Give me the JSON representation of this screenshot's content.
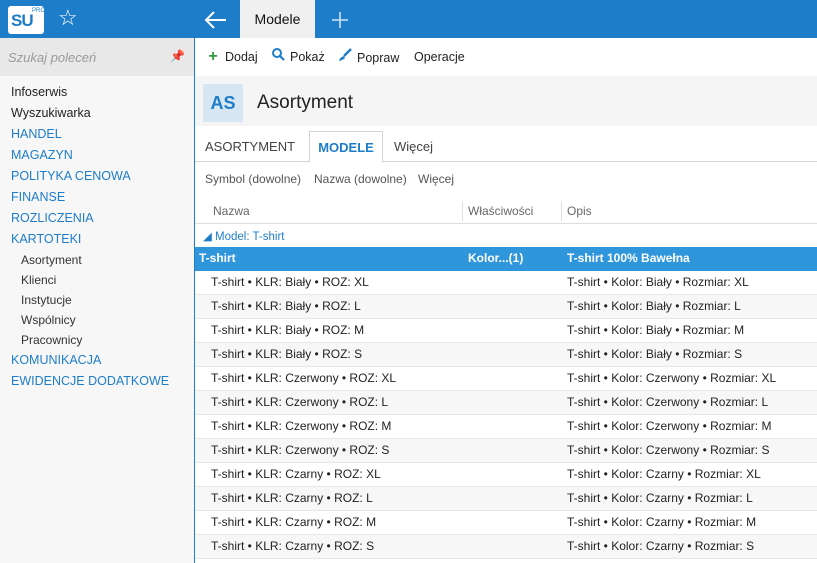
{
  "app": {
    "logo_text": "SU",
    "logo_sup": "PRO",
    "active_tab": "Modele"
  },
  "sidebar": {
    "search_placeholder": "Szukaj poleceń",
    "items": [
      {
        "label": "Infoserwis",
        "kind": "item"
      },
      {
        "label": "Wyszukiwarka",
        "kind": "item"
      },
      {
        "label": "HANDEL",
        "kind": "section"
      },
      {
        "label": "MAGAZYN",
        "kind": "section"
      },
      {
        "label": "POLITYKA CENOWA",
        "kind": "section"
      },
      {
        "label": "FINANSE",
        "kind": "section"
      },
      {
        "label": "ROZLICZENIA",
        "kind": "section"
      },
      {
        "label": "KARTOTEKI",
        "kind": "section"
      },
      {
        "label": "Asortyment",
        "kind": "sub"
      },
      {
        "label": "Klienci",
        "kind": "sub"
      },
      {
        "label": "Instytucje",
        "kind": "sub"
      },
      {
        "label": "Wspólnicy",
        "kind": "sub"
      },
      {
        "label": "Pracownicy",
        "kind": "sub"
      },
      {
        "label": "KOMUNIKACJA",
        "kind": "section"
      },
      {
        "label": "EWIDENCJE DODATKOWE",
        "kind": "section"
      }
    ]
  },
  "toolbar": {
    "add_label": "Dodaj",
    "show_label": "Pokaż",
    "edit_label": "Popraw",
    "operations_label": "Operacje"
  },
  "header": {
    "badge": "AS",
    "title": "Asortyment"
  },
  "tabs": {
    "asortyment": "ASORTYMENT",
    "modele": "MODELE",
    "more": "Więcej"
  },
  "filters": {
    "symbol": "Symbol (dowolne)",
    "name": "Nazwa (dowolne)",
    "more": "Więcej"
  },
  "grid": {
    "columns": [
      "Nazwa",
      "Właściwości",
      "Opis"
    ],
    "group_label": "◢ Model: T-shirt",
    "rows": [
      {
        "name": "T-shirt",
        "props": "Kolor...(1)",
        "desc": "T-shirt 100% Bawełna",
        "selected": true
      },
      {
        "name": "T-shirt  • KLR: Biały • ROZ: XL",
        "props": "",
        "desc": "T-shirt  • Kolor: Biały • Rozmiar: XL"
      },
      {
        "name": "T-shirt  • KLR: Biały • ROZ: L",
        "props": "",
        "desc": "T-shirt  • Kolor: Biały • Rozmiar: L"
      },
      {
        "name": "T-shirt  • KLR: Biały • ROZ: M",
        "props": "",
        "desc": "T-shirt  • Kolor: Biały • Rozmiar: M"
      },
      {
        "name": "T-shirt  • KLR: Biały • ROZ: S",
        "props": "",
        "desc": "T-shirt  • Kolor: Biały • Rozmiar: S"
      },
      {
        "name": "T-shirt  • KLR: Czerwony • ROZ: XL",
        "props": "",
        "desc": "T-shirt  • Kolor: Czerwony • Rozmiar: XL"
      },
      {
        "name": "T-shirt  • KLR: Czerwony • ROZ: L",
        "props": "",
        "desc": "T-shirt  • Kolor: Czerwony • Rozmiar: L"
      },
      {
        "name": "T-shirt  • KLR: Czerwony • ROZ: M",
        "props": "",
        "desc": "T-shirt  • Kolor: Czerwony • Rozmiar: M"
      },
      {
        "name": "T-shirt  • KLR: Czerwony • ROZ: S",
        "props": "",
        "desc": "T-shirt  • Kolor: Czerwony • Rozmiar: S"
      },
      {
        "name": "T-shirt  • KLR: Czarny • ROZ: XL",
        "props": "",
        "desc": "T-shirt  • Kolor: Czarny • Rozmiar: XL"
      },
      {
        "name": "T-shirt  • KLR: Czarny • ROZ: L",
        "props": "",
        "desc": "T-shirt  • Kolor: Czarny • Rozmiar: L"
      },
      {
        "name": "T-shirt  • KLR: Czarny • ROZ: M",
        "props": "",
        "desc": "T-shirt  • Kolor: Czarny • Rozmiar: M"
      },
      {
        "name": "T-shirt  • KLR: Czarny • ROZ: S",
        "props": "",
        "desc": "T-shirt  • Kolor: Czarny • Rozmiar: S"
      }
    ]
  },
  "colors": {
    "accent": "#1e7dc8",
    "selected_row": "#2f96dc"
  }
}
